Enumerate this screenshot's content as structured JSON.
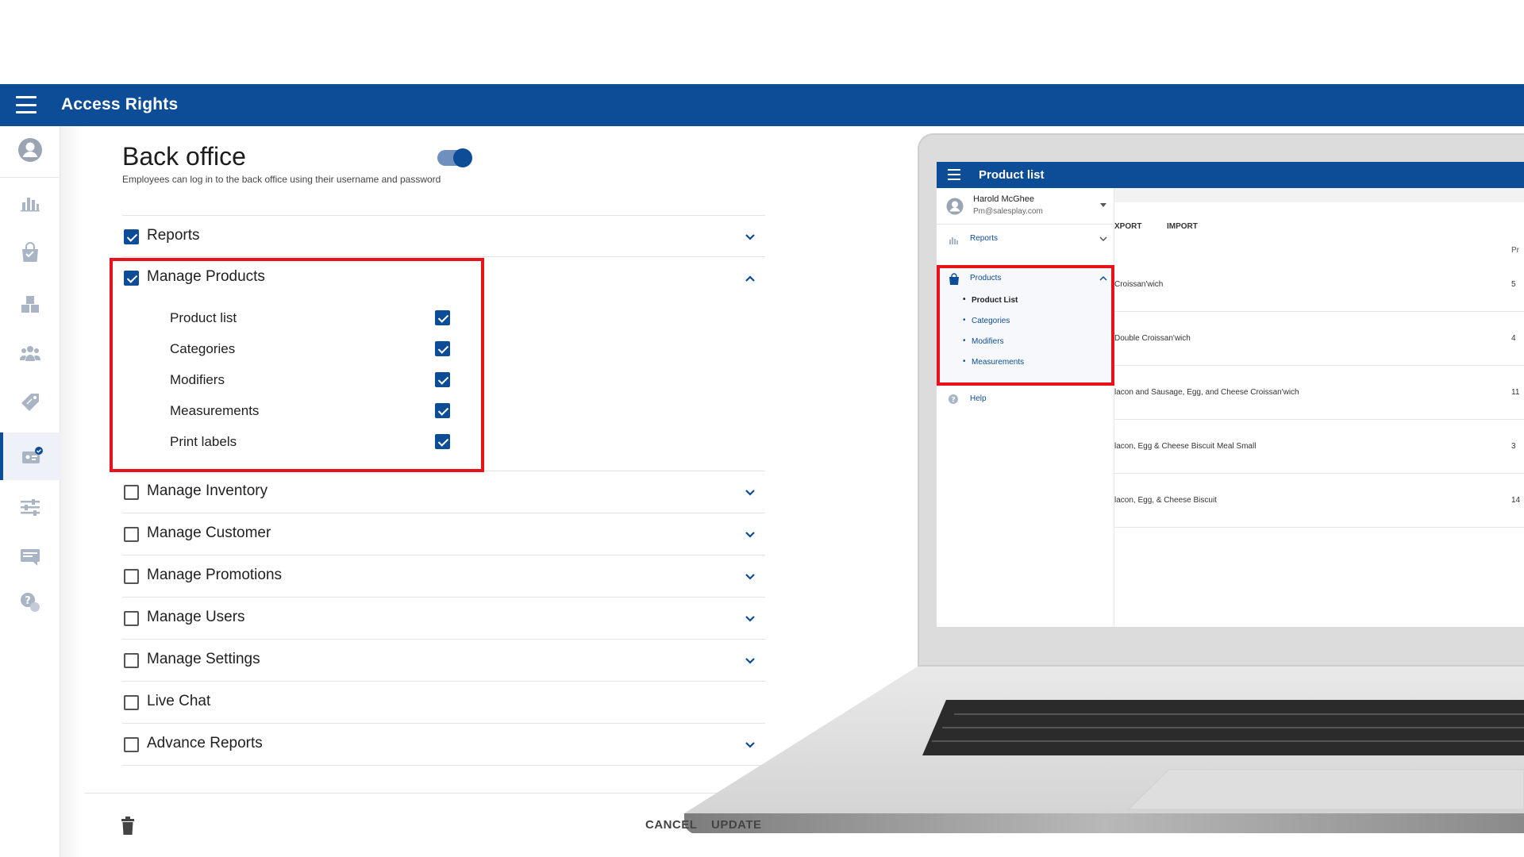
{
  "app": {
    "title": "Access Rights"
  },
  "section": {
    "title": "Back office",
    "subtitle": "Employees can log in to the back office using their username and password",
    "enabled": true
  },
  "permissions": [
    {
      "label": "Reports",
      "checked": true,
      "expandable": true
    },
    {
      "label": "Manage Products",
      "checked": true,
      "expandable": true,
      "expanded": true,
      "items": [
        {
          "label": "Product list",
          "checked": true
        },
        {
          "label": "Categories",
          "checked": true
        },
        {
          "label": "Modifiers",
          "checked": true
        },
        {
          "label": "Measurements",
          "checked": true
        },
        {
          "label": "Print labels",
          "checked": true
        }
      ]
    },
    {
      "label": "Manage Inventory",
      "checked": false,
      "expandable": true
    },
    {
      "label": "Manage Customer",
      "checked": false,
      "expandable": true
    },
    {
      "label": "Manage Promotions",
      "checked": false,
      "expandable": true
    },
    {
      "label": "Manage Users",
      "checked": false,
      "expandable": true
    },
    {
      "label": "Manage Settings",
      "checked": false,
      "expandable": true
    },
    {
      "label": "Live Chat",
      "checked": false,
      "expandable": false
    },
    {
      "label": "Advance Reports",
      "checked": false,
      "expandable": true
    }
  ],
  "footer": {
    "cancel_label": "CANCEL",
    "update_label": "UPDATE"
  },
  "laptop_screen": {
    "title": "Product list",
    "user": {
      "name": "Harold McGhee",
      "email": "Pm@salesplay.com"
    },
    "nav": {
      "reports": "Reports",
      "products": "Products",
      "product_items": [
        "Product List",
        "Categories",
        "Modifiers",
        "Measurements"
      ],
      "help": "Help"
    },
    "toolbar": {
      "export": "XPORT",
      "import": "IMPORT"
    },
    "column_header": "Pr",
    "rows": [
      {
        "name": "Croissan'wich",
        "num": "5"
      },
      {
        "name": "Double Croissan'wich",
        "num": "4"
      },
      {
        "name": "lacon and Sausage, Egg, and Cheese Croissan'wich",
        "num": "11"
      },
      {
        "name": "lacon, Egg & Cheese Biscuit Meal Small",
        "num": "3"
      },
      {
        "name": "lacon, Egg, & Cheese Biscuit",
        "num": "14"
      }
    ]
  },
  "colors": {
    "brand": "#0d4c96",
    "highlight": "#e8121b"
  },
  "icons": [
    "menu-icon",
    "user-circle-icon",
    "bar-chart-icon",
    "shopping-bag-icon",
    "boxes-icon",
    "people-icon",
    "tag-icon",
    "id-card-icon",
    "sliders-icon",
    "message-icon",
    "help-icon",
    "chevron-down-icon",
    "chevron-up-icon",
    "trash-icon"
  ]
}
